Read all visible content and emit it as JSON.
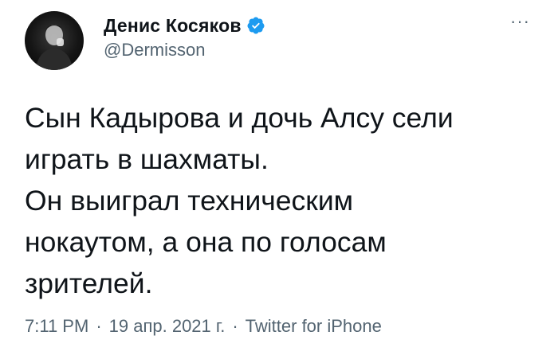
{
  "author": {
    "name": "Денис Косяков",
    "handle": "@Dermisson",
    "verified_icon": "verified-badge-icon",
    "verified_color": "#1d9bf0"
  },
  "more_icon": "more-horizontal-icon",
  "tweet": {
    "text": "Сын Кадырова и дочь Алсу сели\nиграть в шахматы.\nОн выиграл техническим\nнокаутом, а она по голосам\nзрителей."
  },
  "meta": {
    "time": "7:11 PM",
    "separator": "·",
    "date": "19 апр. 2021 г.",
    "source": "Twitter for iPhone"
  }
}
